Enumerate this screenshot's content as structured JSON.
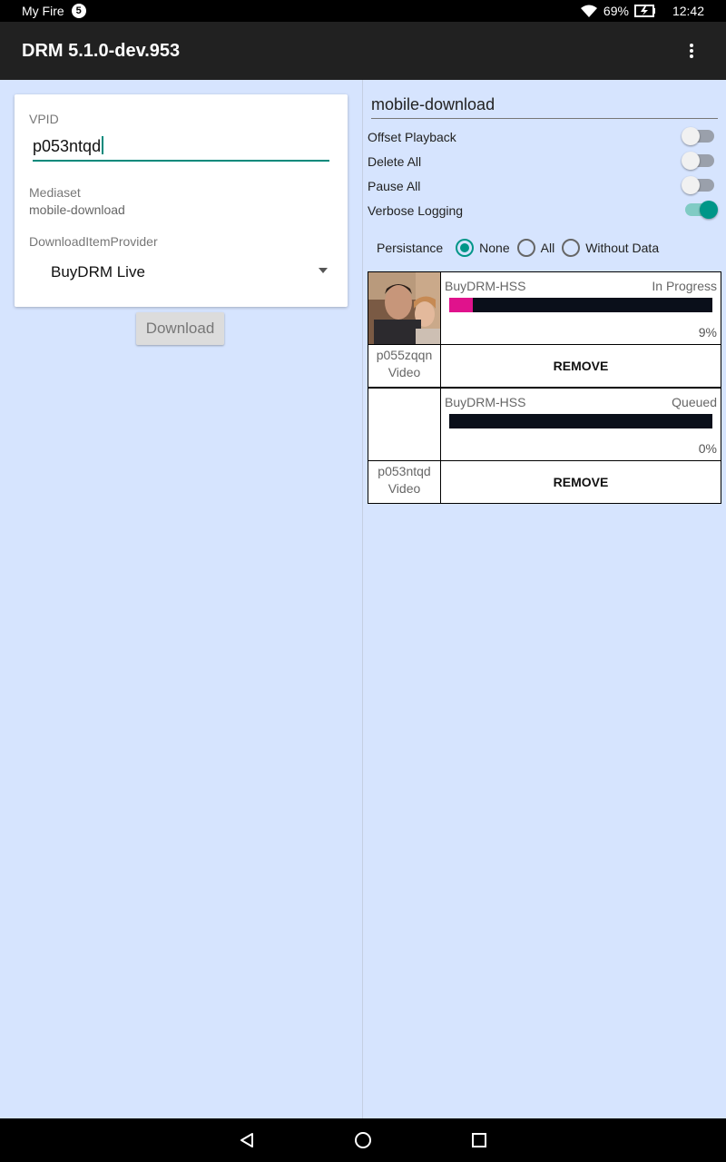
{
  "status_bar": {
    "carrier": "My Fire",
    "notification_count": "5",
    "battery": "69%",
    "time": "12:42",
    "icons": [
      "wifi-icon",
      "battery-charging-icon"
    ]
  },
  "toolbar": {
    "title": "DRM 5.1.0-dev.953",
    "menu_icon": "overflow-menu-icon"
  },
  "form": {
    "vpid_label": "VPID",
    "vpid_value": "p053ntqd",
    "mediaset_label": "Mediaset",
    "mediaset_value": "mobile-download",
    "provider_label": "DownloadItemProvider",
    "provider_value": "BuyDRM Live",
    "download_label": "Download"
  },
  "settings": {
    "mediaset_field": "mobile-download",
    "toggles": [
      {
        "label": "Offset Playback",
        "on": false
      },
      {
        "label": "Delete All",
        "on": false
      },
      {
        "label": "Pause All",
        "on": false
      },
      {
        "label": "Verbose Logging",
        "on": true
      }
    ],
    "persistance_label": "Persistance",
    "persistance_options": [
      {
        "label": "None",
        "selected": true
      },
      {
        "label": "All",
        "selected": false
      },
      {
        "label": "Without Data",
        "selected": false
      }
    ]
  },
  "downloads": [
    {
      "provider": "BuyDRM-HSS",
      "state": "In Progress",
      "progress_percent": 9,
      "percent_label": "9%",
      "vpid": "p055zqqn",
      "kind": "Video",
      "remove_label": "REMOVE",
      "has_thumbnail": true
    },
    {
      "provider": "BuyDRM-HSS",
      "state": "Queued",
      "progress_percent": 0,
      "percent_label": "0%",
      "vpid": "p053ntqd",
      "kind": "Video",
      "remove_label": "REMOVE",
      "has_thumbnail": false
    }
  ],
  "colors": {
    "accent": "#009688",
    "progress_fill": "#e0128c",
    "background": "#d6e4fe",
    "toolbar": "#212121"
  },
  "nav_bar": [
    "back-icon",
    "home-icon",
    "recents-icon"
  ]
}
